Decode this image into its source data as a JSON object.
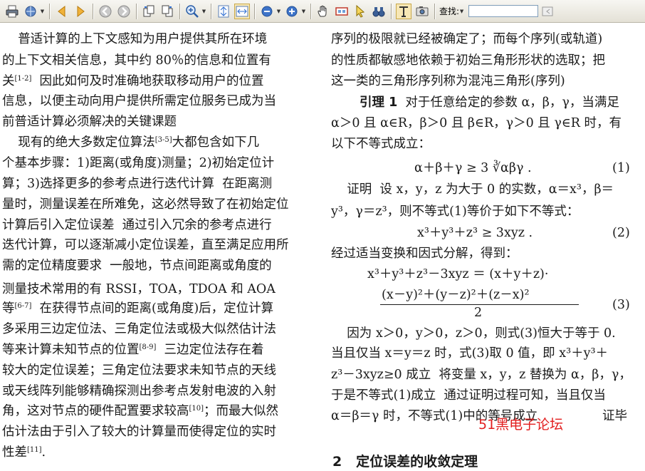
{
  "toolbar": {
    "icons": [
      "print-icon",
      "email-icon",
      "prev-page-icon",
      "next-page-icon",
      "back-icon",
      "forward-icon",
      "rotate-icon",
      "rotate-counter-icon",
      "zoom-in-icon",
      "fit-page-icon",
      "fit-width-icon",
      "zoom-out-button",
      "zoom-in-button",
      "hand-tool-icon",
      "loupe-icon",
      "select-arrow-icon",
      "binoculars-icon",
      "text-select-icon",
      "snapshot-icon",
      "dock-icon"
    ],
    "find_label": "查找:",
    "find_value": ""
  },
  "left_column": [
    "    普适计算的上下文感知为用户提供其所在环境",
    "的上下文相关信息，其中约 80％的信息和位置有",
    "关",
    "信息，以便主动向用户提供所需定位服务已成为当",
    "前普适计算必须解决的关键课题",
    "    现有的绝大多数定位算法",
    "个基本步骤：1)距离(或角度)测量；2)初始定位计",
    "算；3)选择更多的参考点进行迭代计算  在距离测",
    "量时，测量误差在所难免，这必然导致了在初始定位",
    "计算后引入定位误差  通过引入冗余的参考点进行",
    "迭代计算，可以逐渐减小定位误差，直至满足应用所",
    "需的定位精度要求  一般地，节点间距离或角度的",
    "测量技术常用的有 RSSI，TOA，TDOA 和 AOA",
    "等",
    "多采用三边定位法、三角定位法或极大似然估计法",
    "等来计算未知节点的位置",
    "较大的定位误差；三角定位法要求未知节点的天线",
    "或天线阵列能够精确探测出参考点发射电波的入射",
    "角，这对节点的硬件配置要求较高",
    "估计法由于引入了较大的计算量而使得定位的实时",
    "性差"
  ],
  "left_extras": {
    "ref_1_2": "[1-2]",
    "line3_tail": "  因此如何及时准确地获取移动用户的位置",
    "ref_3_5": "[3-5]",
    "line6_tail": "大都包含如下几",
    "ref_6_7": "[6-7]",
    "line14_tail": "  在获得节点间的距离(或角度)后，定位计算",
    "ref_8_9": "[8-9]",
    "line16_tail": "  三边定位法存在着",
    "ref_10": "[10]",
    "line19_tail": "；而最大似然",
    "ref_11": "[11]",
    "line21_tail": "."
  },
  "right_column": {
    "l1": "序列的极限就已经被确定了；而每个序列(或轨道)",
    "l2": "的性质都敏感地依赖于初始三角形形状的选取；把",
    "l3": "这一类的三角形序列称为混沌三角形(序列)",
    "lemma_title": "引理 1",
    "lemma_text": "  对于任意给定的参数 α，β，γ，当满足",
    "l5": "α＞0 且 α∈R，β＞0 且 β∈R，γ＞0 且 γ∈R 时，有",
    "l6": "以下不等式成立：",
    "eq1": "α＋β＋γ ≥ 3 ∛αβγ .",
    "eq1_no": "(1)",
    "proof1": "    证明  设 x，y，z 为大于 0 的实数，α＝x³，β＝",
    "proof2": "y³，γ＝z³，则不等式(1)等价于如下不等式：",
    "eq2": "x³＋y³＋z³ ≥ 3xyz .",
    "eq2_no": "(2)",
    "l_after": "经过适当变换和因式分解，得到：",
    "eq3a": "x³＋y³＋z³－3xyz ＝ (x＋y＋z)·",
    "eq3_num": "(x－y)²＋(y－z)²＋(z－x)²",
    "eq3_den": "2",
    "eq3_no": "(3)",
    "c1": "    因为 x＞0，y＞0，z＞0，则式(3)恒大于等于 0.",
    "c2": "当且仅当 x＝y＝z 时，式(3)取 0 值，即 x³＋y³＋",
    "c3": "z³－3xyz≥0 成立  将变量 x，y，z 替换为 α，β，γ，",
    "c4": "于是不等式(1)成立  通过证明过程可知，当且仅当",
    "c5": "α＝β＝γ 时，不等式(1)中的等号成立",
    "qed": "证毕",
    "heading": "2   定位误差的收敛定理"
  },
  "watermark": "51黑电子论坛"
}
